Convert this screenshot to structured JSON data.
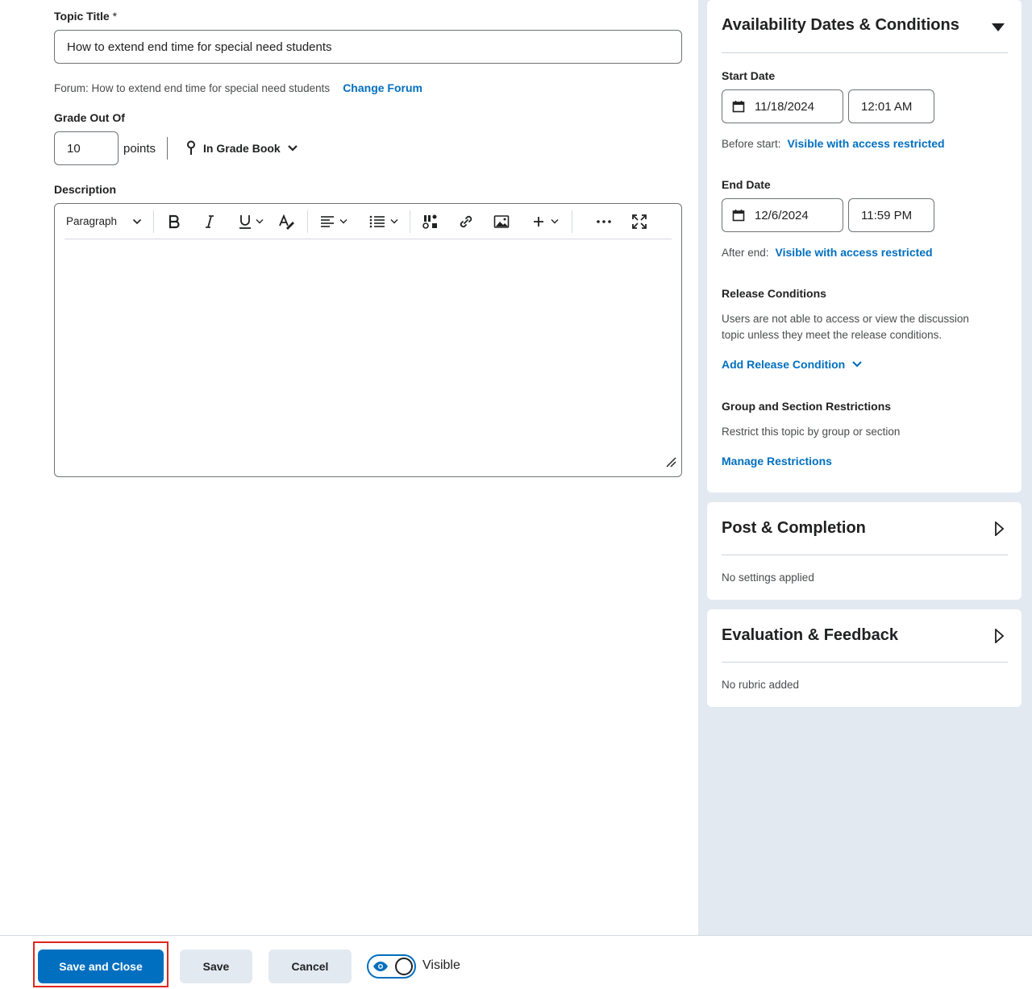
{
  "topic": {
    "title_label": "Topic Title",
    "required_mark": "*",
    "title_value": "How to extend end time for special need students"
  },
  "forum": {
    "text": "Forum: How to extend end time for special need students",
    "change_link": "Change Forum"
  },
  "grade": {
    "label": "Grade Out Of",
    "value": "10",
    "unit": "points",
    "gradebook_label": "In Grade Book"
  },
  "description": {
    "label": "Description",
    "paragraph_style": "Paragraph"
  },
  "availability": {
    "title": "Availability Dates & Conditions",
    "start_label": "Start Date",
    "start_date": "11/18/2024",
    "start_time": "12:01 AM",
    "before_start_label": "Before start:",
    "before_start_value": "Visible with access restricted",
    "end_label": "End Date",
    "end_date": "12/6/2024",
    "end_time": "11:59 PM",
    "after_end_label": "After end:",
    "after_end_value": "Visible with access restricted",
    "release_title": "Release Conditions",
    "release_desc_1": "Users are not able to access or view the discussion",
    "release_desc_2": "topic unless they meet the release conditions.",
    "add_release": "Add Release Condition",
    "group_title": "Group and Section Restrictions",
    "group_desc": "Restrict this topic by group or section",
    "manage_restrictions": "Manage Restrictions"
  },
  "post_completion": {
    "title": "Post & Completion",
    "status": "No settings applied"
  },
  "evaluation": {
    "title": "Evaluation & Feedback",
    "status": "No rubric added"
  },
  "footer": {
    "save_close": "Save and Close",
    "save": "Save",
    "cancel": "Cancel",
    "visibility": "Visible"
  },
  "colors": {
    "accent": "#006fbf",
    "panel_bg": "#e3e9f1",
    "highlight": "#e0261d"
  }
}
